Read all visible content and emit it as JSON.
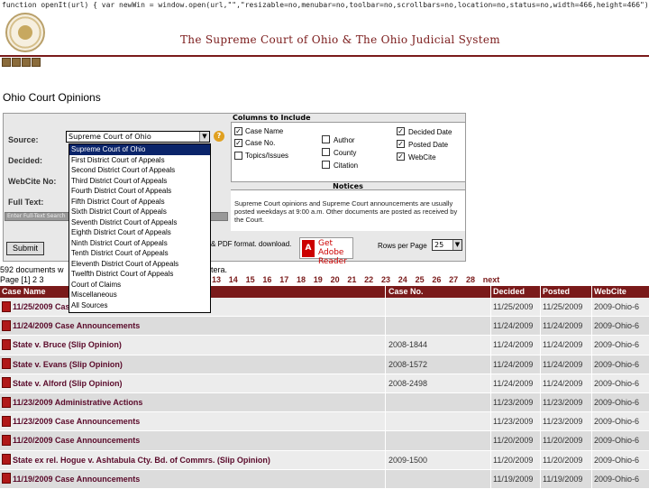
{
  "script_text": "function openIt(url) { var newWin = window.open(url,\"\",\"resizable=no,menubar=no,toolbar=no,scrollbars=no,location=no,status=no,width=466,height=466\"); }",
  "header": {
    "title": "The Supreme Court of Ohio & The Ohio Judicial System"
  },
  "page_title": "Ohio Court Opinions",
  "form": {
    "source_label": "Source:",
    "decided_label": "Decided:",
    "webcite_label": "WebCite No:",
    "fulltext_label": "Full Text:",
    "fulltext_placeholder": "Enter Full-Text Search",
    "source_selected": "Supreme Court of Ohio",
    "source_options": [
      "Supreme Court of Ohio",
      "First District Court of Appeals",
      "Second District Court of Appeals",
      "Third District Court of Appeals",
      "Fourth District Court of Appeals",
      "Fifth District Court of Appeals",
      "Sixth District Court of Appeals",
      "Seventh District Court of Appeals",
      "Eighth District Court of Appeals",
      "Ninth District Court of Appeals",
      "Tenth District Court of Appeals",
      "Eleventh District Court of Appeals",
      "Twelfth District Court of Appeals",
      "Court of Claims",
      "Miscellaneous",
      "All Sources"
    ],
    "submit_label": "Submit",
    "help_symbol": "?"
  },
  "columns": {
    "heading": "Columns to Include",
    "items": [
      {
        "label": "Case Name",
        "checked": true
      },
      {
        "label": "Case No.",
        "checked": true
      },
      {
        "label": "Topics/Issues",
        "checked": false
      },
      {
        "label": "Author",
        "checked": false
      },
      {
        "label": "County",
        "checked": false
      },
      {
        "label": "Citation",
        "checked": false
      },
      {
        "label": "Decided Date",
        "checked": true
      },
      {
        "label": "Posted Date",
        "checked": true
      },
      {
        "label": "WebCite",
        "checked": true
      }
    ]
  },
  "notices": {
    "heading": "Notices",
    "text": "Supreme Court opinions and Supreme Court announcements are usually posted weekdays at 9:00 a.m. Other documents are posted as received by the Court."
  },
  "pdf_note": "& PDF format. download.",
  "adobe": {
    "logo": "A",
    "text": "Get Adobe Reader"
  },
  "rows_per_page": {
    "label": "Rows per Page",
    "value": "25"
  },
  "results": {
    "count_text": "592 documents w",
    "count_tail": "tera.",
    "page_label": "Page [1] 2 3",
    "pages": [
      "13",
      "14",
      "15",
      "16",
      "17",
      "18",
      "19",
      "20",
      "21",
      "22",
      "23",
      "24",
      "25",
      "26",
      "27",
      "28",
      "next"
    ]
  },
  "table": {
    "headers": {
      "name": "Case Name",
      "case": "Case No.",
      "decided": "Decided",
      "posted": "Posted",
      "webcite": "WebCite"
    },
    "rows": [
      {
        "name": "11/25/2009 Case Announcements",
        "case": "",
        "decided": "11/25/2009",
        "posted": "11/25/2009",
        "webcite": "2009-Ohio-6"
      },
      {
        "name": "11/24/2009 Case Announcements",
        "case": "",
        "decided": "11/24/2009",
        "posted": "11/24/2009",
        "webcite": "2009-Ohio-6"
      },
      {
        "name": "State v. Bruce (Slip Opinion)",
        "case": "2008-1844",
        "decided": "11/24/2009",
        "posted": "11/24/2009",
        "webcite": "2009-Ohio-6"
      },
      {
        "name": "State v. Evans (Slip Opinion)",
        "case": "2008-1572",
        "decided": "11/24/2009",
        "posted": "11/24/2009",
        "webcite": "2009-Ohio-6"
      },
      {
        "name": "State v. Alford (Slip Opinion)",
        "case": "2008-2498",
        "decided": "11/24/2009",
        "posted": "11/24/2009",
        "webcite": "2009-Ohio-6"
      },
      {
        "name": "11/23/2009 Administrative Actions",
        "case": "",
        "decided": "11/23/2009",
        "posted": "11/23/2009",
        "webcite": "2009-Ohio-6"
      },
      {
        "name": "11/23/2009 Case Announcements",
        "case": "",
        "decided": "11/23/2009",
        "posted": "11/23/2009",
        "webcite": "2009-Ohio-6"
      },
      {
        "name": "11/20/2009 Case Announcements",
        "case": "",
        "decided": "11/20/2009",
        "posted": "11/20/2009",
        "webcite": "2009-Ohio-6"
      },
      {
        "name": "State ex rel. Hogue v. Ashtabula Cty. Bd. of Commrs. (Slip Opinion)",
        "case": "2009-1500",
        "decided": "11/20/2009",
        "posted": "11/20/2009",
        "webcite": "2009-Ohio-6"
      },
      {
        "name": "11/19/2009 Case Announcements",
        "case": "",
        "decided": "11/19/2009",
        "posted": "11/19/2009",
        "webcite": "2009-Ohio-6"
      }
    ]
  },
  "colors": {
    "brand": "#7a1a1a",
    "highlight": "#0a246a"
  }
}
